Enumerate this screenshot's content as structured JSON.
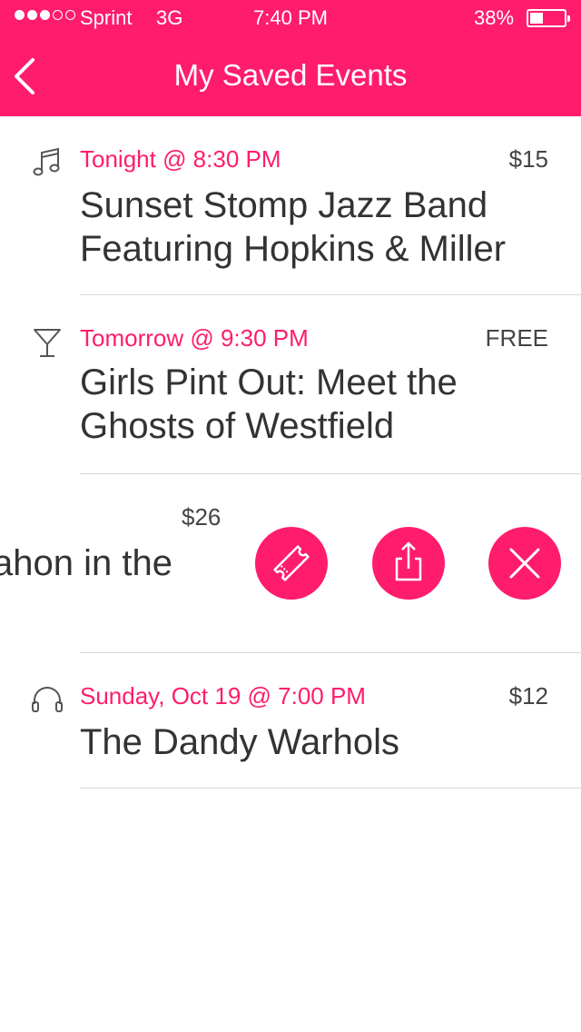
{
  "status_bar": {
    "carrier": "Sprint",
    "network": "3G",
    "time": "7:40 PM",
    "battery_percent": "38%",
    "battery_level": 0.38,
    "signal_bars_filled": 3,
    "signal_bars_total": 5
  },
  "header": {
    "title": "My Saved Events",
    "back_icon": "chevron-left-icon",
    "background_color": "#ff1c6d"
  },
  "events": [
    {
      "icon": "music-note-icon",
      "date": "Tonight @ 8:30 PM",
      "price": "$15",
      "title_line1": "Sunset Stomp Jazz Band",
      "title_line2": "Featuring Hopkins & Miller"
    },
    {
      "icon": "cocktail-glass-icon",
      "date": "Tomorrow @ 9:30 PM",
      "price": "FREE",
      "title_line1": "Girls Pint Out: Meet the",
      "title_line2": "Ghosts of Westfield"
    },
    {
      "price": "$26",
      "title_fragment": "ahon in the",
      "actions": [
        {
          "name": "ticket-button",
          "icon": "ticket-icon"
        },
        {
          "name": "share-button",
          "icon": "share-icon"
        },
        {
          "name": "remove-button",
          "icon": "close-icon"
        }
      ]
    },
    {
      "icon": "headphones-icon",
      "date": "Sunday, Oct 19 @ 7:00 PM",
      "price": "$12",
      "title_line1": "The Dandy Warhols"
    }
  ],
  "colors": {
    "accent": "#ff1c6d",
    "text": "#333333",
    "divider": "#d7d7d7"
  }
}
